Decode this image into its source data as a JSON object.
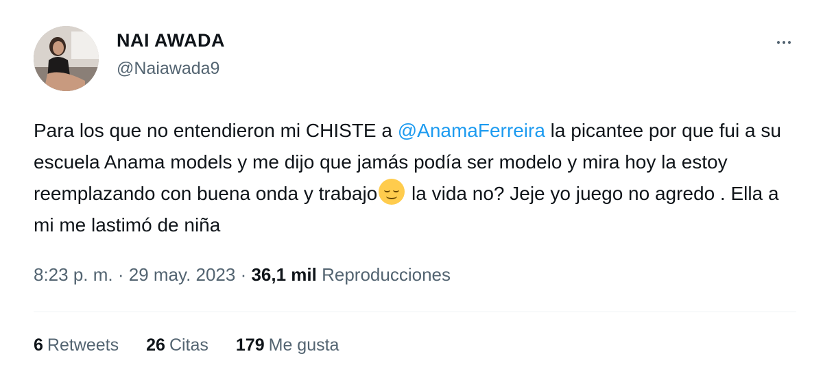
{
  "author": {
    "display_name": "NAI AWADA",
    "handle": "@Naiawada9",
    "avatar_icon": "profile-photo"
  },
  "tweet": {
    "text_before": "Para los que no entendieron mi CHISTE a ",
    "mention": "@AnamaFerreira",
    "text_middle": " la picantee por que fui a su escuela Anama models y me dijo que jamás podía ser modelo y mira hoy la estoy reemplazando con buena onda y trabajo",
    "emoji": "relieved-face-emoji",
    "text_after": " la vida no? Jeje yo juego no agredo . Ella a mi me lastimó de niña"
  },
  "meta": {
    "time": "8:23 p. m.",
    "separator": " · ",
    "date": "29 may. 2023",
    "views_count": "36,1 mil",
    "views_label": "Reproducciones"
  },
  "stats": [
    {
      "count": "6",
      "label": "Retweets"
    },
    {
      "count": "26",
      "label": "Citas"
    },
    {
      "count": "179",
      "label": "Me gusta"
    }
  ],
  "colors": {
    "accent": "#1d9bf0",
    "text_primary": "#0f1419",
    "text_secondary": "#536471",
    "divider": "#eff3f4"
  }
}
